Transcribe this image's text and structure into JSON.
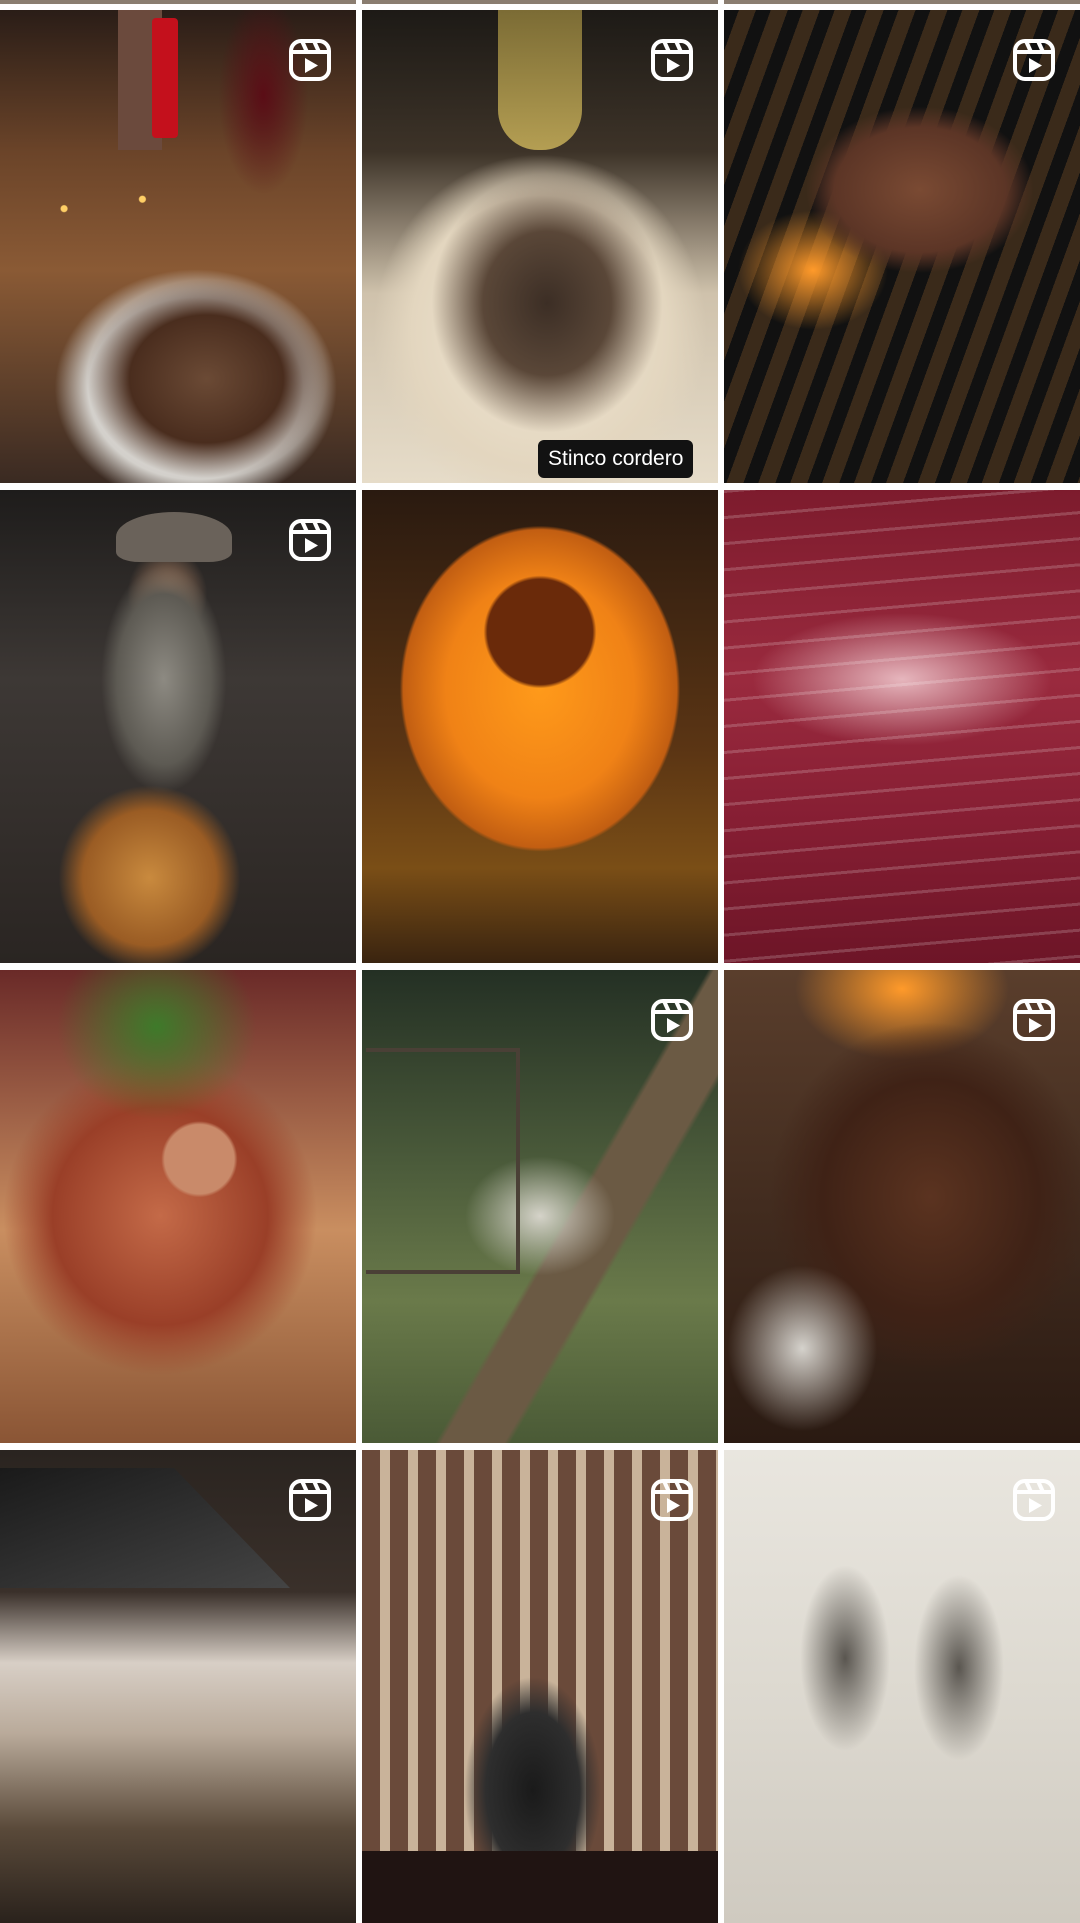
{
  "grid": {
    "tiles": [
      {
        "id": 1,
        "alt": "",
        "is_reel": true
      },
      {
        "id": 2,
        "alt": "",
        "is_reel": true,
        "overlay_label": "Stinco cordero"
      },
      {
        "id": 3,
        "alt": "",
        "is_reel": true
      },
      {
        "id": 4,
        "alt": "",
        "is_reel": true
      },
      {
        "id": 5,
        "alt": "",
        "is_reel": false
      },
      {
        "id": 6,
        "alt": "",
        "is_reel": false
      },
      {
        "id": 7,
        "alt": "",
        "is_reel": false
      },
      {
        "id": 8,
        "alt": "",
        "is_reel": true
      },
      {
        "id": 9,
        "alt": "",
        "is_reel": true
      },
      {
        "id": 10,
        "alt": "",
        "is_reel": true
      },
      {
        "id": 11,
        "alt": "",
        "is_reel": true
      },
      {
        "id": 12,
        "alt": "",
        "is_reel": true
      }
    ],
    "reel_icon": "reels-icon",
    "colors": {
      "background": "#ffffff",
      "label_bg": "#121212",
      "label_text": "#ffffff",
      "icon": "#ffffff"
    }
  }
}
